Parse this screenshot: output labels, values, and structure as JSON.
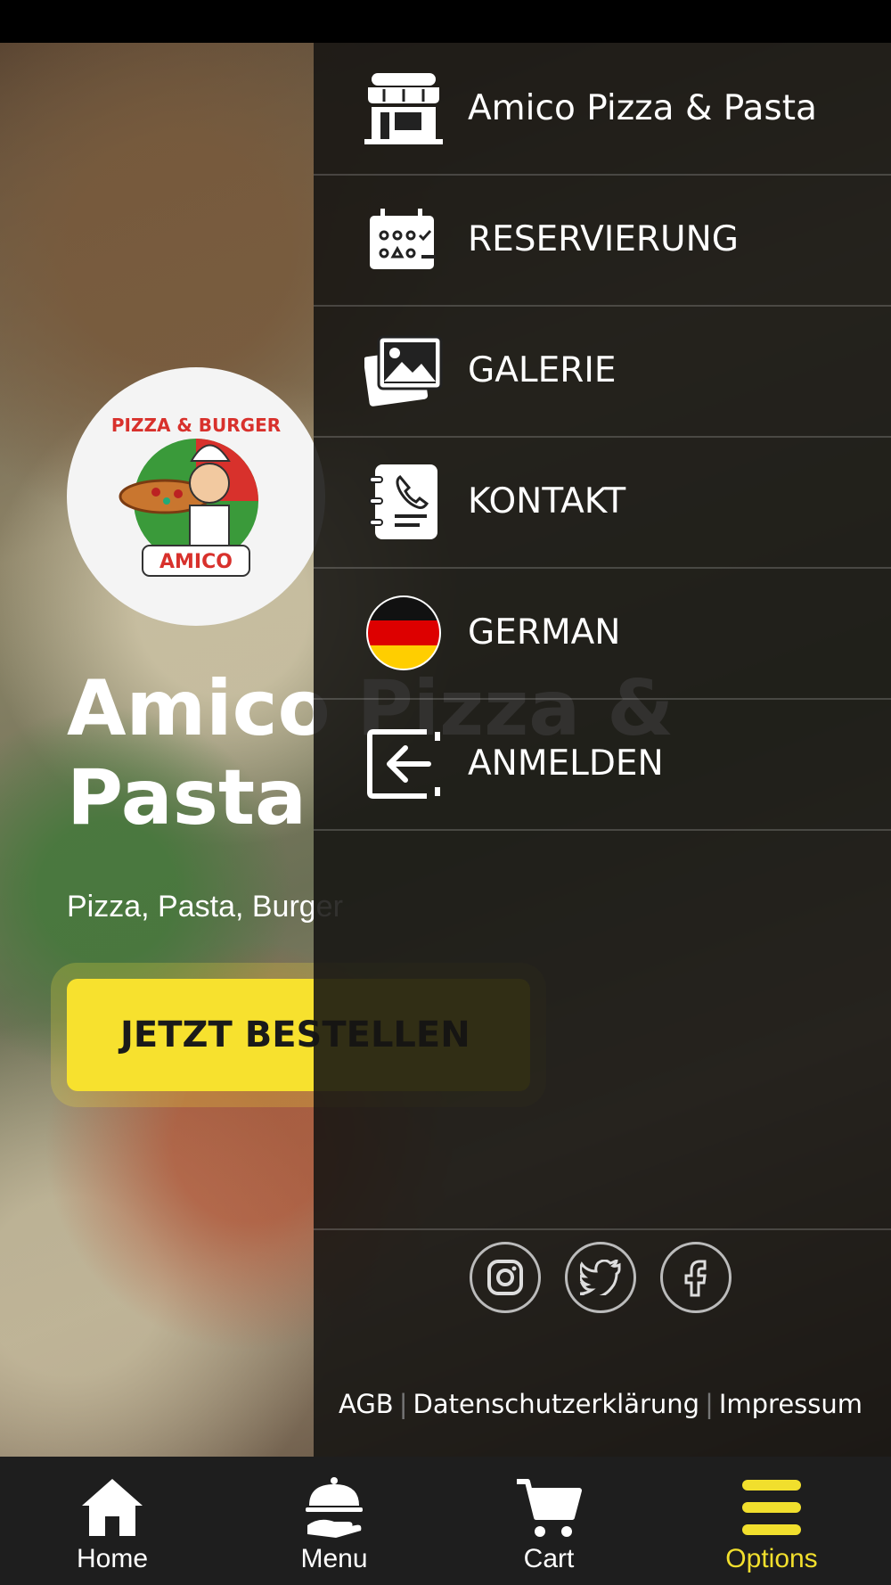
{
  "hero": {
    "title": "Amico Pizza &\nPasta",
    "subtitle": "Pizza, Pasta, Burger",
    "cta_label": "JETZT BESTELLEN",
    "logo_text_top": "PIZZA & BURGER",
    "logo_text_bottom": "AMICO"
  },
  "drawer": {
    "items": [
      {
        "label": "Amico Pizza & Pasta",
        "icon": "store-icon"
      },
      {
        "label": "RESERVIERUNG",
        "icon": "calendar-icon"
      },
      {
        "label": "GALERIE",
        "icon": "gallery-icon"
      },
      {
        "label": "KONTAKT",
        "icon": "contact-book-icon"
      },
      {
        "label": "GERMAN",
        "icon": "german-flag-icon"
      },
      {
        "label": "ANMELDEN",
        "icon": "login-icon"
      }
    ],
    "social": [
      "instagram-icon",
      "twitter-icon",
      "facebook-icon"
    ],
    "footer_links": [
      "AGB",
      "Datenschutzerklärung",
      "Impressum"
    ]
  },
  "bottom_nav": {
    "items": [
      {
        "label": "Home",
        "icon": "home-icon"
      },
      {
        "label": "Menu",
        "icon": "cloche-icon"
      },
      {
        "label": "Cart",
        "icon": "cart-icon"
      },
      {
        "label": "Options",
        "icon": "menu-bars-icon",
        "active": true
      }
    ]
  },
  "colors": {
    "accent": "#f1df2d",
    "drawer_bg": "#161412",
    "nav_bg": "#1e1e1e"
  }
}
